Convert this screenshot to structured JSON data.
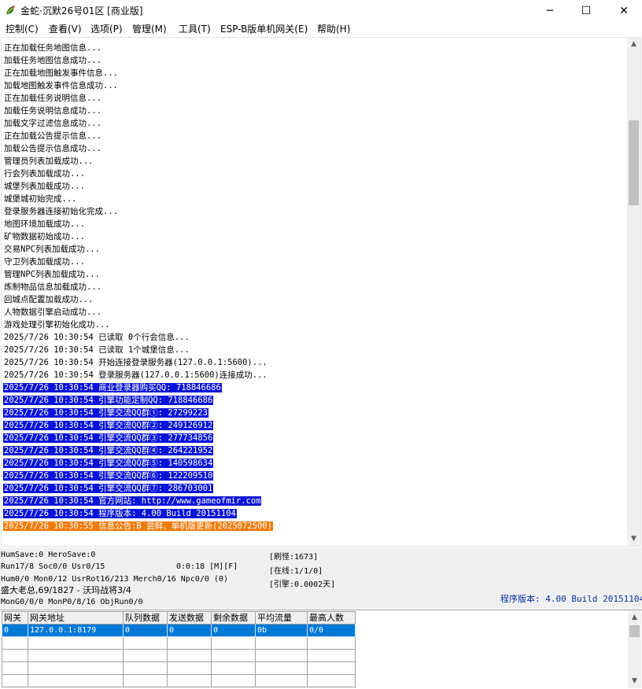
{
  "window": {
    "title": "金蛇·沉默26号01区 [商业版]",
    "minimize_glyph": "─",
    "maximize_glyph": "☐",
    "close_glyph": "✕",
    "icon": "app-dragon-icon"
  },
  "menu": [
    {
      "label": "控制(C)"
    },
    {
      "label": "查看(V)"
    },
    {
      "label": "选项(P)"
    },
    {
      "label": "管理(M)"
    },
    {
      "label": "工具(T)"
    },
    {
      "label": "ESP-B版单机网关(E)"
    },
    {
      "label": "帮助(H)"
    }
  ],
  "log": {
    "lines": [
      {
        "text": "正在加载任务地图信息...",
        "style": "plain"
      },
      {
        "text": "加载任务地图信息成功...",
        "style": "plain"
      },
      {
        "text": "正在加载地图触发事件信息...",
        "style": "plain"
      },
      {
        "text": "加载地图触发事件信息成功...",
        "style": "plain"
      },
      {
        "text": "正在加载任务说明信息...",
        "style": "plain"
      },
      {
        "text": "加载任务说明信息成功...",
        "style": "plain"
      },
      {
        "text": "加载文字过滤信息成功...",
        "style": "plain"
      },
      {
        "text": "正在加载公告提示信息...",
        "style": "plain"
      },
      {
        "text": "加载公告提示信息成功...",
        "style": "plain"
      },
      {
        "text": "管理员列表加载成功...",
        "style": "plain"
      },
      {
        "text": "行会列表加载成功...",
        "style": "plain"
      },
      {
        "text": "城堡列表加载成功...",
        "style": "plain"
      },
      {
        "text": "城堡城初始完成...",
        "style": "plain"
      },
      {
        "text": "登录服务器连接初始化完成...",
        "style": "plain"
      },
      {
        "text": "地图环境加载成功...",
        "style": "plain"
      },
      {
        "text": "矿物数据初始成功...",
        "style": "plain"
      },
      {
        "text": "交易NPC列表加载成功...",
        "style": "plain"
      },
      {
        "text": "守卫列表加载成功...",
        "style": "plain"
      },
      {
        "text": "管理NPC列表加载成功...",
        "style": "plain"
      },
      {
        "text": "炼制物品信息加载成功...",
        "style": "plain"
      },
      {
        "text": "回城点配置加载成功...",
        "style": "plain"
      },
      {
        "text": "人物数据引擎启动成功...",
        "style": "plain"
      },
      {
        "text": "游戏处理引擎初始化成功...",
        "style": "plain"
      },
      {
        "text": "2025/7/26 10:30:54 已读取 0个行会信息...",
        "style": "plain"
      },
      {
        "text": "2025/7/26 10:30:54 已读取 1个城堡信息...",
        "style": "plain"
      },
      {
        "text": "2025/7/26 10:30:54 开始连接登录服务器(127.0.0.1:5600)...",
        "style": "plain"
      },
      {
        "text": "2025/7/26 10:30:54 登录服务器(127.0.0.1:5600)连接成功...",
        "style": "plain"
      },
      {
        "text": "2025/7/26 10:30:54 商业登录器购买QQ: 718846686",
        "style": "hl"
      },
      {
        "text": "2025/7/26 10:30:54 引擎功能定制QQ: 718846686",
        "style": "hl"
      },
      {
        "text": "2025/7/26 10:30:54 引擎交流QQ群①: 27299223",
        "style": "hl"
      },
      {
        "text": "2025/7/26 10:30:54 引擎交流QQ群②: 249126912",
        "style": "hl"
      },
      {
        "text": "2025/7/26 10:30:54 引擎交流QQ群③: 277734856",
        "style": "hl"
      },
      {
        "text": "2025/7/26 10:30:54 引擎交流QQ群④: 264221952",
        "style": "hl"
      },
      {
        "text": "2025/7/26 10:30:54 引擎交流QQ群⑤: 140598634",
        "style": "hl"
      },
      {
        "text": "2025/7/26 10:30:54 引擎交流QQ群⑥: 122209510",
        "style": "hl"
      },
      {
        "text": "2025/7/26 10:30:54 引擎交流QQ群⑦: 286703001",
        "style": "hl"
      },
      {
        "text": "2025/7/26 10:30:54 官方网站: http://www.gameofmir.com",
        "style": "hl"
      },
      {
        "text": "2025/7/26 10:30:54 程序版本: 4.00 Build 20151104",
        "style": "hl"
      },
      {
        "text": "2025/7/26 10:30:55 信息公告:B 尝鲜、单机版更新(2025072500)",
        "style": "notice"
      }
    ]
  },
  "status": {
    "line1": "HumSave:0 HeroSave:0",
    "line2": "Run17/8 Soc0/0 Usr0/15",
    "timer": "0:0:18 [M][F]",
    "line3": "Hum0/0 Mon0/12 UsrRot16/213 Merch0/16 Npc0/0 (0)",
    "line4": "盛大老总,69/1827 - 沃玛战将3/4",
    "line5": "MonG0/0/0 MonP0/8/16 ObjRun0/0",
    "refresh": "[刷怪:1673]",
    "online": "[在线:1/1/0]",
    "engine": "[引擎:0.0002天]",
    "version": "程序版本: 4.00 Build 20151104"
  },
  "gateway": {
    "columns": [
      "网关",
      "网关地址",
      "队列数据",
      "发送数据",
      "剩余数据",
      "平均流量",
      "最高人数"
    ],
    "rows": [
      [
        "0",
        "127.0.0.1:8179",
        "0",
        "0",
        "0",
        "0b",
        "0/0"
      ],
      [
        "",
        "",
        "",
        "",
        "",
        "",
        ""
      ],
      [
        "",
        "",
        "",
        "",
        "",
        "",
        ""
      ],
      [
        "",
        "",
        "",
        "",
        "",
        "",
        ""
      ],
      [
        "",
        "",
        "",
        "",
        "",
        "",
        ""
      ]
    ]
  },
  "colors": {
    "highlight": "#0a14d8",
    "notice": "#f07b0c",
    "selection": "#0078d7",
    "version_text": "#0a2f9e"
  }
}
